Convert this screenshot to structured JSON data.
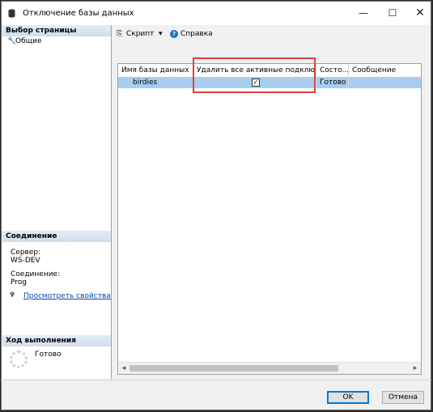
{
  "window": {
    "title": "Отключение базы данных",
    "min": "—",
    "max": "☐",
    "close": "✕"
  },
  "left": {
    "select_page_header": "Выбор страницы",
    "pages": [
      {
        "label": "Общие",
        "icon": "wrench-icon"
      }
    ],
    "connection_header": "Соединение",
    "server_label": "Сервер:",
    "server_value": "WS-DEV",
    "connection_label": "Соединение:",
    "connection_value": "Prog",
    "view_props_link": "Просмотреть свойства соед",
    "progress_header": "Ход выполнения",
    "progress_status": "Готово"
  },
  "toolbar": {
    "script_label": "Скрипт",
    "dropdown_glyph": "▾",
    "help_label": "Справка"
  },
  "grid": {
    "columns": [
      "Имя базы данных",
      "Удалить все активные подключения",
      "Состо...",
      "Сообщение"
    ],
    "rows": [
      {
        "name": "birdies",
        "drop_connections": true,
        "status": "Готово",
        "message": ""
      }
    ]
  },
  "footer": {
    "ok_label": "OK",
    "cancel_label": "Отмена"
  },
  "colors": {
    "selected_row": "#a8cdef",
    "highlight_box": "#d9453d",
    "link": "#0645ad"
  }
}
